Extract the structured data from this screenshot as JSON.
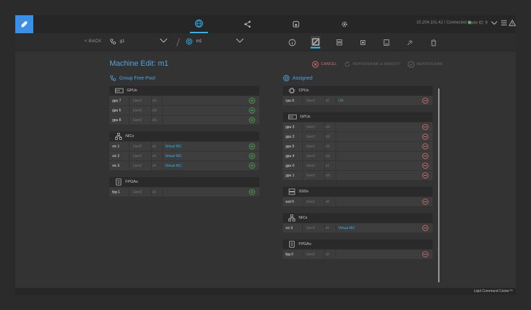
{
  "topbar": {
    "status_text": "10.204.101.42 / Connected",
    "node_label": "Node ID:",
    "node_value": "9"
  },
  "toolbar": {
    "back_label": "< BACK",
    "group_value": "g1",
    "machine_value": "m1"
  },
  "page": {
    "title": "Machine Edit: m1",
    "cancel_label": "CANCEL",
    "reprogram_reboot_label": "REPROGRAM & REBOOT",
    "reprogram_label": "REPROGRAM"
  },
  "pool": {
    "title": "Group Free Pool",
    "groups": [
      {
        "label": "GPUs",
        "icon": "gpu-icon",
        "rows": [
          {
            "name": "gpu 7",
            "gen": "Gen3",
            "lanes": "x16",
            "extra": ""
          },
          {
            "name": "gpu 6",
            "gen": "Gen3",
            "lanes": "x16",
            "extra": ""
          },
          {
            "name": "gpu 8",
            "gen": "Gen3",
            "lanes": "x16",
            "extra": ""
          }
        ]
      },
      {
        "label": "NICs",
        "icon": "network-icon",
        "rows": [
          {
            "name": "vic 1",
            "gen": "Gen3",
            "lanes": "x4",
            "extra": "Virtual NIC"
          },
          {
            "name": "vic 2",
            "gen": "Gen3",
            "lanes": "x4",
            "extra": "Virtual NIC"
          },
          {
            "name": "vic 3",
            "gen": "Gen3",
            "lanes": "x4",
            "extra": "Virtual NIC"
          }
        ]
      },
      {
        "label": "FPGAs",
        "icon": "fpga-icon",
        "rows": [
          {
            "name": "fpg 1",
            "gen": "Gen3",
            "lanes": "x0",
            "extra": ""
          }
        ]
      }
    ]
  },
  "assigned": {
    "title": "Assigned",
    "groups": [
      {
        "label": "CPUs",
        "icon": "cpu-icon",
        "rows": [
          {
            "name": "cpu 0",
            "gen": "Gen3",
            "lanes": "x0",
            "extra": "ON"
          }
        ]
      },
      {
        "label": "GPUs",
        "icon": "gpu-icon",
        "rows": [
          {
            "name": "gpu 3",
            "gen": "Gen3",
            "lanes": "x16",
            "extra": ""
          },
          {
            "name": "gpu 2",
            "gen": "Gen3",
            "lanes": "x16",
            "extra": ""
          },
          {
            "name": "gpu 5",
            "gen": "Gen3",
            "lanes": "x16",
            "extra": ""
          },
          {
            "name": "gpu 4",
            "gen": "Gen3",
            "lanes": "x16",
            "extra": ""
          },
          {
            "name": "gpu 0",
            "gen": "Gen3",
            "lanes": "x1",
            "extra": ""
          },
          {
            "name": "gpu 1",
            "gen": "Gen3",
            "lanes": "x16",
            "extra": ""
          }
        ]
      },
      {
        "label": "SSDs",
        "icon": "ssd-icon",
        "rows": [
          {
            "name": "ssd 0",
            "gen": "Gen3",
            "lanes": "x4",
            "extra": ""
          }
        ]
      },
      {
        "label": "NICs",
        "icon": "network-icon",
        "rows": [
          {
            "name": "vic 0",
            "gen": "Gen3",
            "lanes": "x4",
            "extra": "Virtual NIC"
          }
        ]
      },
      {
        "label": "FPGAs",
        "icon": "fpga-icon",
        "rows": [
          {
            "name": "fpg 0",
            "gen": "Gen3",
            "lanes": "x0",
            "extra": ""
          }
        ]
      }
    ]
  },
  "footer": {
    "brand": "Liqid Command Center™"
  },
  "colors": {
    "accent": "#29b6f6",
    "title": "#4fa6e0",
    "add": "#4caf50",
    "remove": "#e57373"
  }
}
